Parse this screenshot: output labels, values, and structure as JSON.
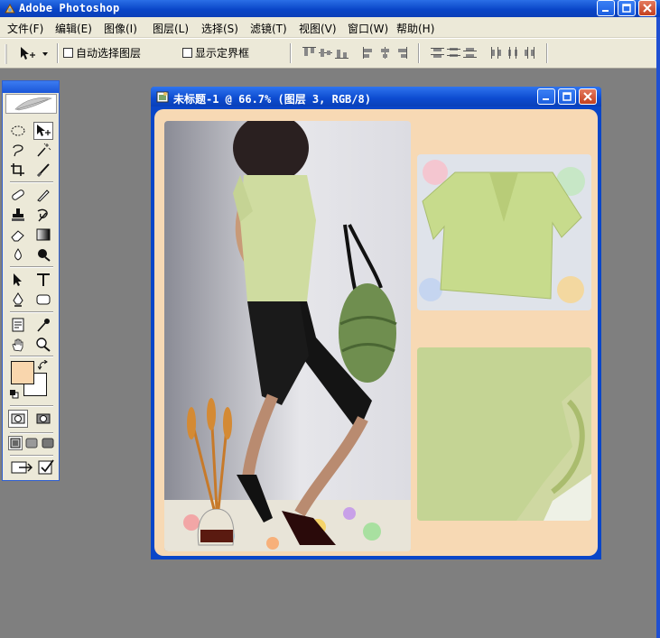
{
  "app": {
    "title": "Adobe Photoshop"
  },
  "menu": [
    {
      "label": "文件(F)"
    },
    {
      "label": "编辑(E)"
    },
    {
      "label": "图像(I)"
    },
    {
      "label": "图层(L)"
    },
    {
      "label": "选择(S)"
    },
    {
      "label": "滤镜(T)"
    },
    {
      "label": "视图(V)"
    },
    {
      "label": "窗口(W)"
    },
    {
      "label": "帮助(H)"
    }
  ],
  "options": {
    "auto_select_label": "自动选择图层",
    "auto_select_checked": false,
    "show_bounds_label": "显示定界框",
    "show_bounds_checked": false
  },
  "document": {
    "title": "未标题-1 @ 66.7% (图层 3, RGB/8)",
    "background_color": "#f7d9b4"
  },
  "colors": {
    "foreground": "#f9d6ad",
    "background": "#ffffff",
    "titlebar": "#0a46c8"
  },
  "tools": [
    "marquee-tool-icon",
    "move-tool-icon",
    "lasso-tool-icon",
    "magic-wand-tool-icon",
    "crop-tool-icon",
    "slice-tool-icon",
    "healing-brush-tool-icon",
    "brush-tool-icon",
    "clone-stamp-tool-icon",
    "history-brush-tool-icon",
    "eraser-tool-icon",
    "gradient-tool-icon",
    "blur-tool-icon",
    "dodge-tool-icon",
    "path-selection-tool-icon",
    "type-tool-icon",
    "pen-tool-icon",
    "shape-tool-icon",
    "notes-tool-icon",
    "eyedropper-tool-icon",
    "hand-tool-icon",
    "zoom-tool-icon"
  ]
}
